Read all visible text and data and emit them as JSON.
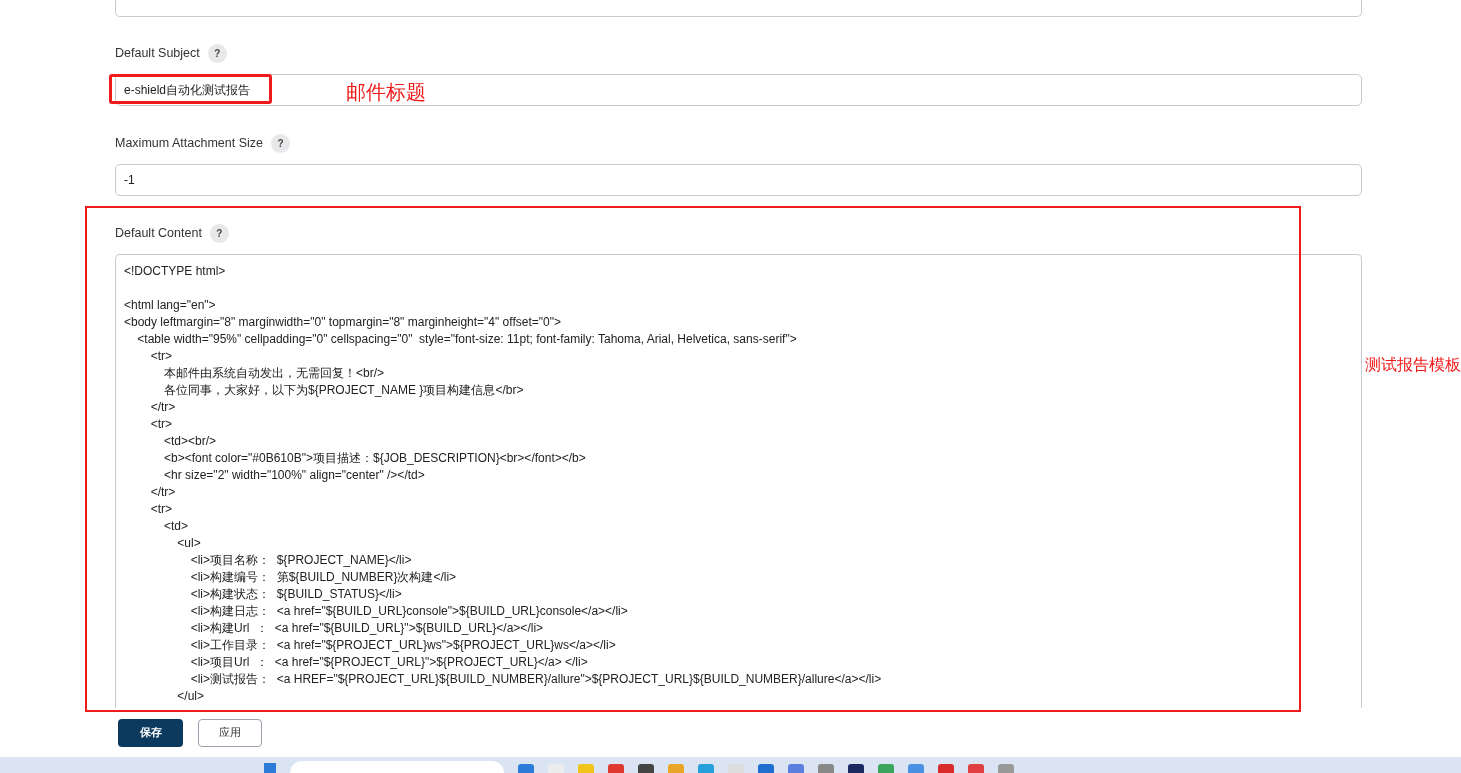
{
  "fields": [
    {
      "kind": "input",
      "label": "Default Subject",
      "help": "?",
      "value": "e-shield自动化测试报告",
      "annotation": "邮件标题"
    },
    {
      "kind": "input",
      "label": "Maximum Attachment Size",
      "help": "?",
      "value": "-1"
    },
    {
      "kind": "textarea",
      "label": "Default Content",
      "help": "?",
      "annotation": "测试报告模板",
      "value": "<!DOCTYPE html>\n\n<html lang=\"en\">\n<body leftmargin=\"8\" marginwidth=\"0\" topmargin=\"8\" marginheight=\"4\" offset=\"0\">\n    <table width=\"95%\" cellpadding=\"0\" cellspacing=\"0\"  style=\"font-size: 11pt; font-family: Tahoma, Arial, Helvetica, sans-serif\">\n        <tr>\n            本邮件由系统自动发出，无需回复！<br/>\n            各位同事，大家好，以下为${PROJECT_NAME }项目构建信息</br>\n        </tr>\n        <tr>\n            <td><br/>\n            <b><font color=\"#0B610B\">项目描述：${JOB_DESCRIPTION}<br></font></b>\n            <hr size=\"2\" width=\"100%\" align=\"center\" /></td>\n        </tr>\n        <tr>\n            <td>\n                <ul>\n                    <li>项目名称：  ${PROJECT_NAME}</li>\n                    <li>构建编号：  第${BUILD_NUMBER}次构建</li>\n                    <li>构建状态：  ${BUILD_STATUS}</li>\n                    <li>构建日志：  <a href=\"${BUILD_URL}console\">${BUILD_URL}console</a></li>\n                    <li>构建Url  ：  <a href=\"${BUILD_URL}\">${BUILD_URL}</a></li>\n                    <li>工作目录：  <a href=\"${PROJECT_URL}ws\">${PROJECT_URL}ws</a></li>\n                    <li>项目Url  ：  <a href=\"${PROJECT_URL}\">${PROJECT_URL}</a> </li>\n                    <li>测试报告：  <a HREF=\"${PROJECT_URL}${BUILD_NUMBER}/allure\">${PROJECT_URL}${BUILD_NUMBER}/allure</a></li>\n                </ul>"
    }
  ],
  "buttons": [
    {
      "label": "保存",
      "kind": "primary"
    },
    {
      "label": "应用",
      "kind": "secondary"
    }
  ]
}
